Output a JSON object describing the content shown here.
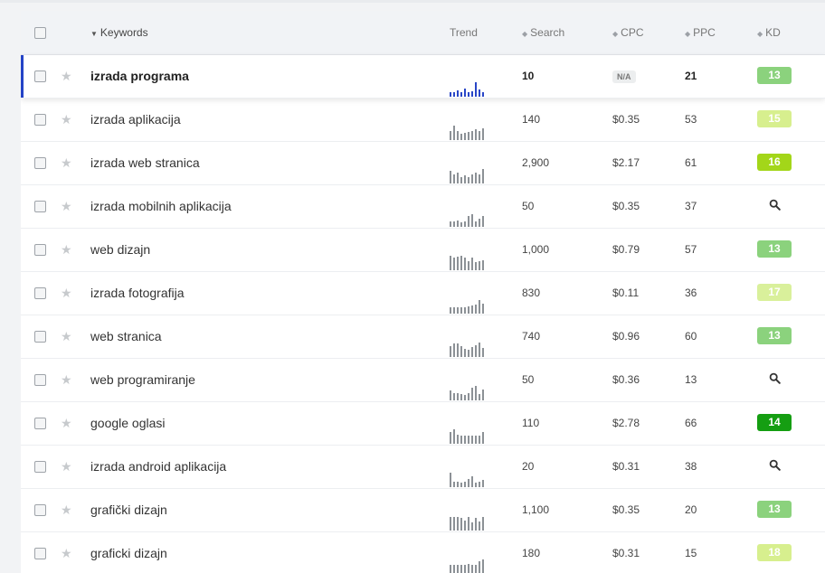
{
  "header": {
    "keywords": "Keywords",
    "trend": "Trend",
    "search": "Search",
    "cpc": "CPC",
    "ppc": "PPC",
    "kd": "KD"
  },
  "icons": {
    "star": "star-icon",
    "search": "search-icon",
    "sort": "sort-icon",
    "sort_down": "caret-down-icon"
  },
  "colors": {
    "accent": "#2443c6",
    "kd_13": "#8bd27d",
    "kd_15": "#d7ef8e",
    "kd_16": "#a3d619",
    "kd_17": "#d9f09b",
    "kd_14": "#159e12",
    "kd_18": "#d7ef8e"
  },
  "rows": [
    {
      "keyword": "izrada programa",
      "search": "10",
      "cpc": "N/A",
      "ppc": "21",
      "kd": "13",
      "kd_color": "#8bd27d",
      "active": true,
      "trend": [
        0.3,
        0.3,
        0.45,
        0.3,
        0.55,
        0.3,
        0.4,
        1.0,
        0.5,
        0.3
      ]
    },
    {
      "keyword": "izrada aplikacija",
      "search": "140",
      "cpc": "$0.35",
      "ppc": "53",
      "kd": "15",
      "kd_color": "#d7ef8e",
      "trend": [
        0.65,
        1.0,
        0.6,
        0.45,
        0.5,
        0.55,
        0.6,
        0.75,
        0.6,
        0.8
      ]
    },
    {
      "keyword": "izrada web stranica",
      "search": "2,900",
      "cpc": "$2.17",
      "ppc": "61",
      "kd": "16",
      "kd_color": "#a3d619",
      "trend": [
        0.85,
        0.6,
        0.75,
        0.45,
        0.55,
        0.45,
        0.6,
        0.75,
        0.6,
        1.0
      ]
    },
    {
      "keyword": "izrada mobilnih aplikacija",
      "search": "50",
      "cpc": "$0.35",
      "ppc": "37",
      "kd": null,
      "trend": [
        0.35,
        0.35,
        0.45,
        0.3,
        0.35,
        0.75,
        0.9,
        0.35,
        0.55,
        0.75
      ]
    },
    {
      "keyword": "web dizajn",
      "search": "1,000",
      "cpc": "$0.79",
      "ppc": "57",
      "kd": "13",
      "kd_color": "#8bd27d",
      "trend": [
        1.0,
        0.85,
        0.95,
        1.0,
        0.85,
        0.6,
        0.85,
        0.55,
        0.65,
        0.7
      ]
    },
    {
      "keyword": "izrada fotografija",
      "search": "830",
      "cpc": "$0.11",
      "ppc": "36",
      "kd": "17",
      "kd_color": "#d9f09b",
      "trend": [
        0.45,
        0.45,
        0.45,
        0.45,
        0.45,
        0.5,
        0.55,
        0.6,
        0.95,
        0.7
      ]
    },
    {
      "keyword": "web stranica",
      "search": "740",
      "cpc": "$0.96",
      "ppc": "60",
      "kd": "13",
      "kd_color": "#8bd27d",
      "trend": [
        0.75,
        0.95,
        0.95,
        0.75,
        0.55,
        0.5,
        0.7,
        0.8,
        1.0,
        0.6
      ]
    },
    {
      "keyword": "web programiranje",
      "search": "50",
      "cpc": "$0.36",
      "ppc": "13",
      "kd": null,
      "trend": [
        0.7,
        0.5,
        0.5,
        0.45,
        0.4,
        0.5,
        0.85,
        1.0,
        0.45,
        0.75
      ]
    },
    {
      "keyword": "google oglasi",
      "search": "110",
      "cpc": "$2.78",
      "ppc": "66",
      "kd": "14",
      "kd_color": "#159e12",
      "trend": [
        0.8,
        1.0,
        0.6,
        0.55,
        0.55,
        0.55,
        0.55,
        0.55,
        0.55,
        0.8
      ]
    },
    {
      "keyword": "izrada android aplikacija",
      "search": "20",
      "cpc": "$0.31",
      "ppc": "38",
      "kd": null,
      "trend": [
        1.0,
        0.35,
        0.35,
        0.3,
        0.35,
        0.55,
        0.75,
        0.3,
        0.35,
        0.5
      ]
    },
    {
      "keyword": "grafički dizajn",
      "search": "1,100",
      "cpc": "$0.35",
      "ppc": "20",
      "kd": "13",
      "kd_color": "#8bd27d",
      "trend": [
        0.95,
        0.95,
        0.95,
        0.85,
        0.7,
        0.95,
        0.55,
        0.85,
        0.65,
        0.95
      ]
    },
    {
      "keyword": "graficki dizajn",
      "search": "180",
      "cpc": "$0.31",
      "ppc": "15",
      "kd": "18",
      "kd_color": "#d7ef8e",
      "trend": [
        0.6,
        0.65,
        0.6,
        0.65,
        0.6,
        0.7,
        0.6,
        0.65,
        0.85,
        1.0
      ]
    }
  ]
}
